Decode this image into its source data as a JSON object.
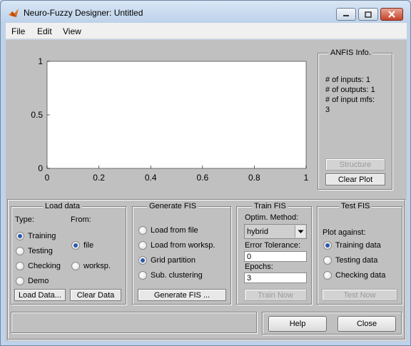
{
  "window": {
    "title": "Neuro-Fuzzy Designer: Untitled",
    "controls": [
      "minimize-icon",
      "maximize-icon",
      "close-icon"
    ]
  },
  "menu": {
    "items": [
      "File",
      "Edit",
      "View"
    ]
  },
  "plot": {
    "y_ticks": [
      "1",
      "0.5",
      "0"
    ],
    "x_ticks": [
      "0",
      "0.2",
      "0.4",
      "0.6",
      "0.8",
      "1"
    ]
  },
  "anfis_info": {
    "title": "ANFIS Info.",
    "lines": [
      "# of inputs: 1",
      "# of outputs: 1",
      "# of input mfs:",
      "3"
    ],
    "structure_button": "Structure",
    "clear_plot_button": "Clear Plot"
  },
  "load_data": {
    "title": "Load data",
    "type_label": "Type:",
    "from_label": "From:",
    "types": [
      {
        "label": "Training",
        "selected": true
      },
      {
        "label": "Testing",
        "selected": false
      },
      {
        "label": "Checking",
        "selected": false
      },
      {
        "label": "Demo",
        "selected": false
      }
    ],
    "sources": [
      {
        "label": "file",
        "selected": true
      },
      {
        "label": "worksp.",
        "selected": false
      }
    ],
    "load_button": "Load Data...",
    "clear_button": "Clear Data"
  },
  "generate_fis": {
    "title": "Generate FIS",
    "options": [
      {
        "label": "Load from file",
        "selected": false
      },
      {
        "label": "Load from worksp.",
        "selected": false
      },
      {
        "label": "Grid partition",
        "selected": true
      },
      {
        "label": "Sub. clustering",
        "selected": false
      }
    ],
    "generate_button": "Generate FIS ..."
  },
  "train_fis": {
    "title": "Train FIS",
    "method_label": "Optim. Method:",
    "method_value": "hybrid",
    "error_label": "Error Tolerance:",
    "error_value": "0",
    "epochs_label": "Epochs:",
    "epochs_value": "3",
    "train_button": "Train Now"
  },
  "test_fis": {
    "title": "Test FIS",
    "plot_against_label": "Plot against:",
    "options": [
      {
        "label": "Training data",
        "selected": true
      },
      {
        "label": "Testing data",
        "selected": false
      },
      {
        "label": "Checking data",
        "selected": false
      }
    ],
    "test_button": "Test Now"
  },
  "footer": {
    "status_text": "",
    "help_button": "Help",
    "close_button": "Close"
  },
  "colors": {
    "panel_bg": "#c0c0c0",
    "radio_dot": "#2a5aa8",
    "window_frame": "#bed2ea"
  }
}
